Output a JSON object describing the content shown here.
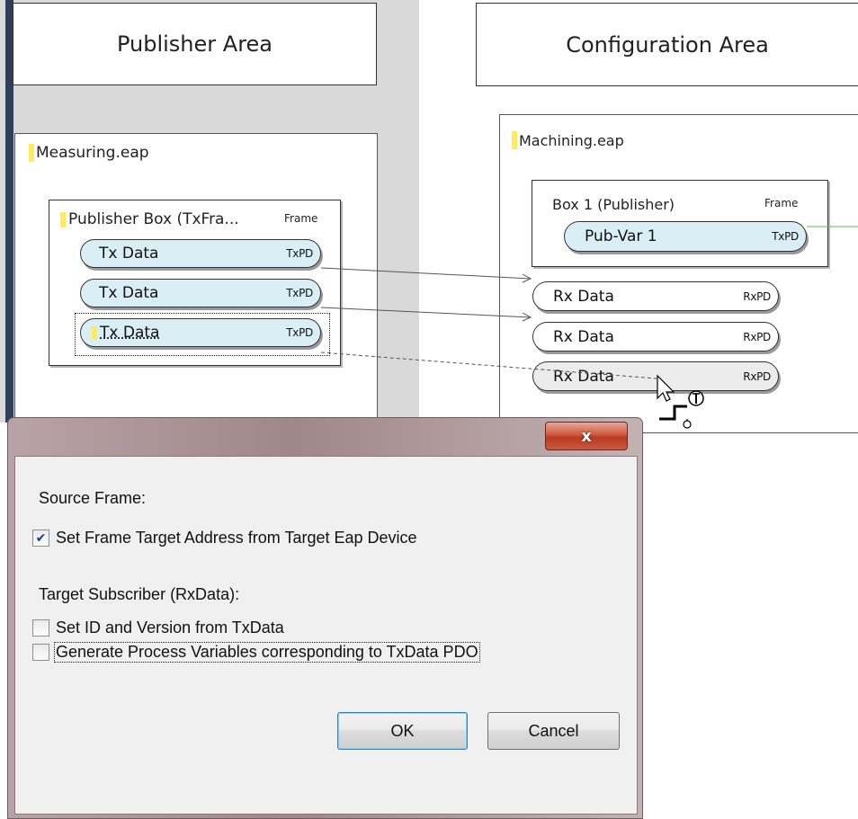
{
  "publisher_area": {
    "title": "Publisher Area",
    "eap_file": "Measuring.eap",
    "box": {
      "title": "Publisher Box (TxFra...",
      "type_tag": "Frame",
      "items": [
        {
          "label": "Tx Data",
          "tag": "TxPD"
        },
        {
          "label": "Tx Data",
          "tag": "TxPD"
        },
        {
          "label": "Tx Data",
          "tag": "TxPD"
        }
      ]
    }
  },
  "configuration_area": {
    "title": "Configuration Area",
    "eap_file": "Machining.eap",
    "box": {
      "title": "Box 1 (Publisher)",
      "type_tag": "Frame",
      "item": {
        "label": "Pub-Var 1",
        "tag": "TxPD"
      }
    },
    "rx_items": [
      {
        "label": "Rx Data",
        "tag": "RxPD"
      },
      {
        "label": "Rx Data",
        "tag": "RxPD"
      },
      {
        "label": "Rx Data",
        "tag": "RxPD"
      }
    ]
  },
  "dialog": {
    "close_label": "x",
    "source_frame_label": "Source Frame:",
    "set_frame_target_label": "Set Frame Target Address from Target Eap Device",
    "set_frame_target_checked": true,
    "target_subscriber_label": "Target Subscriber (RxData):",
    "set_id_version_label": "Set ID and Version from TxData",
    "set_id_version_checked": false,
    "generate_pv_label": "Generate Process Variables corresponding to TxData PDO",
    "generate_pv_checked": false,
    "ok_label": "OK",
    "cancel_label": "Cancel"
  },
  "colors": {
    "publisher_panel_bg": "#d9d9d9",
    "pill_fill": "#d9eef5",
    "marker_yellow": "#ffeb5c",
    "close_button_red": "#c94a33",
    "link_green": "#5cb85c"
  }
}
